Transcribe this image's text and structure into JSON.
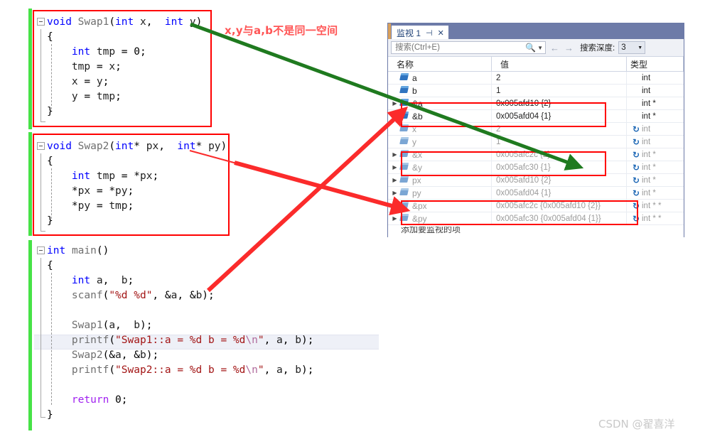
{
  "editor": {
    "blocks": [
      {
        "id": "swap1",
        "lines": [
          "void Swap1(int x,  int y)",
          "{",
          "    int tmp = 0;",
          "    tmp = x;",
          "    x = y;",
          "    y = tmp;",
          "}"
        ]
      },
      {
        "id": "swap2",
        "lines": [
          "void Swap2(int* px,  int* py)",
          "{",
          "    int tmp = *px;",
          "    *px = *py;",
          "    *py = tmp;",
          "}"
        ]
      },
      {
        "id": "main",
        "lines": [
          "int main()",
          "{",
          "    int a,  b;",
          "    scanf(\"%d %d\", &a, &b);",
          "",
          "    Swap1(a,  b);",
          "    printf(\"Swap1::a = %d b = %d\\n\", a, b);",
          "    Swap2(&a, &b);",
          "    printf(\"Swap2::a = %d b = %d\\n\", a, b);",
          "",
          "    return 0;",
          "}"
        ]
      }
    ]
  },
  "annotation": {
    "note_text": "x,y与a,b不是同一空间",
    "note_color": "#ff5555",
    "green_arrow_color": "#1f7a1f",
    "red_arrow_color": "#fb2b2b"
  },
  "watch": {
    "tab_label": "监视 1",
    "pin_icon": "pin-icon",
    "close_icon": "close-icon",
    "search_placeholder": "搜索(Ctrl+E)",
    "search_value": "",
    "search_icon": "search-icon",
    "search_dropdown_icon": "chevron-down-icon",
    "back_icon": "arrow-left-icon",
    "forward_icon": "arrow-right-icon",
    "depth_label": "搜索深度:",
    "depth_value": "3",
    "depth_dropdown_icon": "chevron-down-icon",
    "columns": [
      "名称",
      "值",
      "类型"
    ],
    "add_item_text": "添加要监视的项",
    "rows": [
      {
        "expander": false,
        "name": "a",
        "value": "2",
        "type": "int",
        "dim": false,
        "refresh": false
      },
      {
        "expander": false,
        "name": "b",
        "value": "1",
        "type": "int",
        "dim": false,
        "refresh": false
      },
      {
        "expander": true,
        "name": "&a",
        "value": "0x005afd10 {2}",
        "type": "int *",
        "dim": false,
        "refresh": false
      },
      {
        "expander": true,
        "name": "&b",
        "value": "0x005afd04 {1}",
        "type": "int *",
        "dim": false,
        "refresh": false
      },
      {
        "expander": false,
        "name": "x",
        "value": "2",
        "type": "int",
        "dim": true,
        "refresh": true
      },
      {
        "expander": false,
        "name": "y",
        "value": "1",
        "type": "int",
        "dim": true,
        "refresh": true
      },
      {
        "expander": true,
        "name": "&x",
        "value": "0x005afc2c {2}",
        "type": "int *",
        "dim": true,
        "refresh": true
      },
      {
        "expander": true,
        "name": "&y",
        "value": "0x005afc30 {1}",
        "type": "int *",
        "dim": true,
        "refresh": true
      },
      {
        "expander": true,
        "name": "px",
        "value": "0x005afd10 {2}",
        "type": "int *",
        "dim": true,
        "refresh": true
      },
      {
        "expander": true,
        "name": "py",
        "value": "0x005afd04 {1}",
        "type": "int *",
        "dim": true,
        "refresh": true
      },
      {
        "expander": true,
        "name": "&px",
        "value": "0x005afc2c {0x005afd10 {2}}",
        "type": "int * *",
        "dim": true,
        "refresh": true
      },
      {
        "expander": true,
        "name": "&py",
        "value": "0x005afc30 {0x005afd04 {1}}",
        "type": "int * *",
        "dim": true,
        "refresh": true
      }
    ]
  },
  "watermark": {
    "text": "CSDN @翟喜洋"
  },
  "colors": {
    "titlebar": "#6d7ba8",
    "toolbar": "#eff1f6",
    "redbox": "#ff0000",
    "changebar": "#46e246",
    "keyword": "#0000ff",
    "string": "#a31515"
  }
}
